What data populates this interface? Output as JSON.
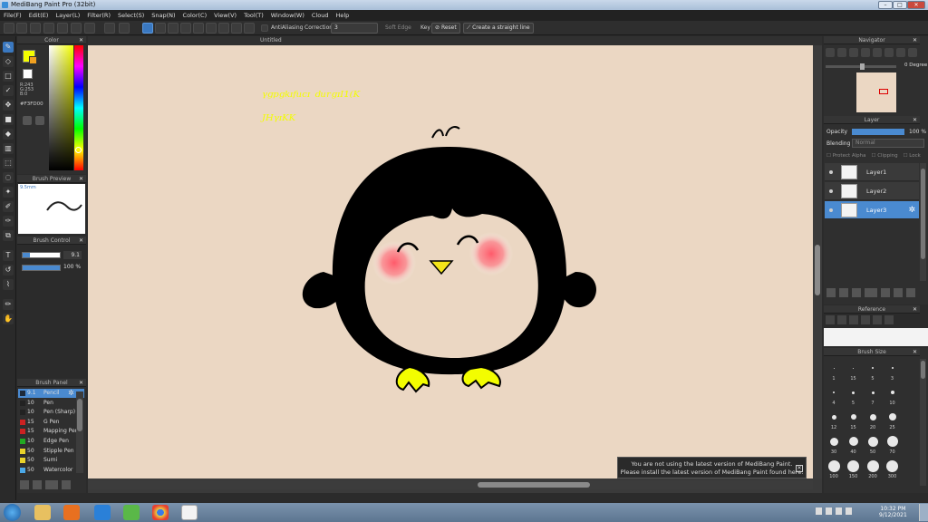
{
  "window": {
    "title": "MediBang Paint Pro (32bit)",
    "controls": [
      "–",
      "□",
      "✕"
    ]
  },
  "menu": [
    "File(F)",
    "Edit(E)",
    "Layer(L)",
    "Filter(R)",
    "Select(S)",
    "Snap(N)",
    "Color(C)",
    "View(V)",
    "Tool(T)",
    "Window(W)",
    "Cloud",
    "Help"
  ],
  "toolbar": {
    "antialias_label": "AntiAliasing",
    "correction_label": "Correction",
    "correction_value": "3",
    "softedge_label": "Soft Edge",
    "key_label": "Key",
    "reset_label": "Reset",
    "straight_label": "Create a straight line"
  },
  "color_panel": {
    "title": "Color",
    "r": "R:243",
    "g": "G:253",
    "b": "B:0",
    "hex": "#F3FD00",
    "primary": "#f3fd00",
    "secondary": "#ffffff"
  },
  "brush_preview": {
    "title": "Brush Preview",
    "size": "9.5mm"
  },
  "brush_control": {
    "title": "Brush Control",
    "size_value": "9.1",
    "opacity_value": "100 %"
  },
  "brush_panel": {
    "title": "Brush Panel",
    "items": [
      {
        "size": "9.1",
        "name": "Pencil",
        "color": "#1e2a3a"
      },
      {
        "size": "10",
        "name": "Pen",
        "color": "#222222"
      },
      {
        "size": "10",
        "name": "Pen (Sharp)",
        "color": "#222222"
      },
      {
        "size": "15",
        "name": "G Pen",
        "color": "#cc2222"
      },
      {
        "size": "15",
        "name": "Mapping Pen",
        "color": "#cc2222"
      },
      {
        "size": "10",
        "name": "Edge Pen",
        "color": "#22aa22"
      },
      {
        "size": "50",
        "name": "Stipple Pen",
        "color": "#e8d22a"
      },
      {
        "size": "50",
        "name": "Sumi",
        "color": "#e8d22a"
      },
      {
        "size": "50",
        "name": "Watercolor",
        "color": "#4aa8e8"
      }
    ]
  },
  "document": {
    "tab": "Untitled"
  },
  "canvas": {
    "handwriting_line1": "ᵞᵍᵖᵍᵏᶦᶠᵘᶜᶦ ᵈᵘʳᵍᶦᴵ¹⁽ᴷ",
    "handwriting_line2": "ᴶᴴᵞᶦᴷᴷ"
  },
  "navigator": {
    "title": "Navigator",
    "degree": "0 Degree"
  },
  "layer_panel": {
    "title": "Layer",
    "opacity_label": "Opacity",
    "opacity_value": "100 %",
    "blending_label": "Blending",
    "blending_value": "Normal",
    "protect_alpha": "Protect Alpha",
    "clipping": "Clipping",
    "lock": "Lock",
    "layers": [
      "Layer1",
      "Layer2",
      "Layer3"
    ]
  },
  "reference": {
    "title": "Reference"
  },
  "brush_size": {
    "title": "Brush Size",
    "labels": [
      "1",
      "15",
      "5",
      "3",
      "4",
      "5",
      "7",
      "10",
      "12",
      "15",
      "20",
      "25",
      "30",
      "40",
      "50",
      "70",
      "100",
      "150",
      "200",
      "300"
    ]
  },
  "notification": {
    "line1": "You are not using the latest version of MediBang Paint.",
    "line2": "Please install the latest version of MediBang Paint found here."
  },
  "taskbar": {
    "time": "10:32 PM",
    "date": "9/12/2021"
  }
}
